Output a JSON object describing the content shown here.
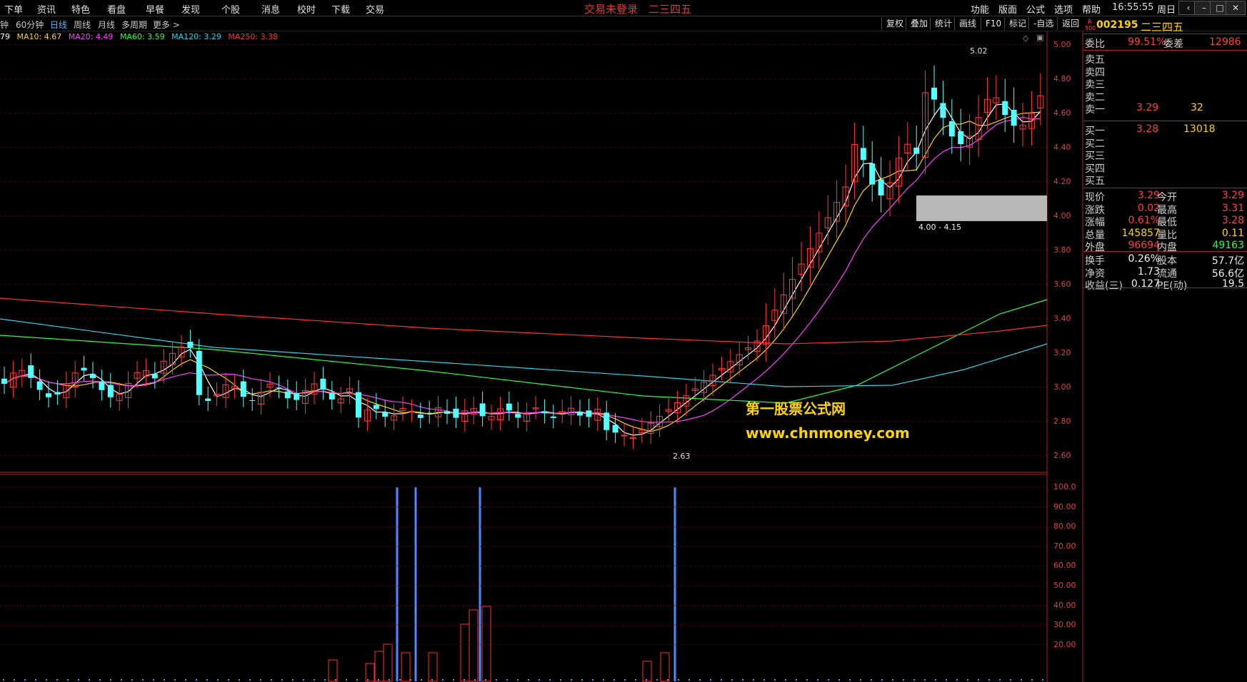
{
  "menubar": {
    "left_items": [
      "下单",
      "资讯",
      "特色",
      "看盘",
      "早餐",
      "发现",
      "个股",
      "消息",
      "校时",
      "下载",
      "交易"
    ],
    "title": "交易未登录　二三四五",
    "right_items": [
      "功能",
      "版面",
      "公式",
      "选项",
      "帮助"
    ],
    "clock": "16:55:55",
    "weekday": "周日",
    "window_buttons": [
      "‹",
      "–",
      "□",
      "✕"
    ]
  },
  "toolbar": {
    "periods": [
      "钟",
      "60分钟",
      "日线",
      "周线",
      "月线",
      "多周期",
      "更多 >"
    ],
    "active_period": "日线",
    "right_buttons": [
      "复权",
      "叠加",
      "统计",
      "画线",
      "F10",
      "标记",
      "-自选",
      "返回"
    ]
  },
  "ma_legend": [
    {
      "label": "79",
      "color": "#ffffff"
    },
    {
      "label": "MA10: 4.67",
      "color": "#ffd400"
    },
    {
      "label": "MA20: 4.49",
      "color": "#ff3cff"
    },
    {
      "label": "MA60: 3.59",
      "color": "#2bff3e"
    },
    {
      "label": "MA120: 3.29",
      "color": "#2bd4e8"
    },
    {
      "label": "MA250: 3.38",
      "color": "#ff3030"
    }
  ],
  "main_chart": {
    "y_ticks": [
      "5.00",
      "4.80",
      "4.60",
      "4.40",
      "4.20",
      "4.00",
      "3.80",
      "3.60",
      "3.40",
      "3.20",
      "3.00",
      "2.80",
      "2.60"
    ],
    "high_marker": "5.02",
    "low_marker": "2.63",
    "zone_label": "4.00 - 4.15",
    "y_range": [
      2.55,
      5.08
    ]
  },
  "indicator": {
    "y_ticks": [
      "100.0",
      "90.00",
      "80.00",
      "70.00",
      "60.00",
      "50.00",
      "40.00",
      "30.00",
      "20.00"
    ]
  },
  "watermark": {
    "line1": "第一股票公式网",
    "line2": "www.chnmoney.com"
  },
  "quote_panel": {
    "badge_top": "R",
    "badge_bottom": "500",
    "code": "002195",
    "name": "二三四五",
    "weibi_label": "委比",
    "weibi_value": "99.51%",
    "weicha_label": "委差",
    "weicha_value": "12986",
    "sell": [
      {
        "label": "卖五",
        "price": "",
        "vol": ""
      },
      {
        "label": "卖四",
        "price": "",
        "vol": ""
      },
      {
        "label": "卖三",
        "price": "",
        "vol": ""
      },
      {
        "label": "卖二",
        "price": "",
        "vol": ""
      },
      {
        "label": "卖一",
        "price": "3.29",
        "vol": "32"
      }
    ],
    "buy": [
      {
        "label": "买一",
        "price": "3.28",
        "vol": "13018"
      },
      {
        "label": "买二",
        "price": "",
        "vol": ""
      },
      {
        "label": "买三",
        "price": "",
        "vol": ""
      },
      {
        "label": "买四",
        "price": "",
        "vol": ""
      },
      {
        "label": "买五",
        "price": "",
        "vol": ""
      }
    ],
    "stats": [
      {
        "l1": "现价",
        "v1": "3.29",
        "c1": "red",
        "l2": "今开",
        "v2": "3.29",
        "c2": "red"
      },
      {
        "l1": "涨跌",
        "v1": "0.02",
        "c1": "red",
        "l2": "最高",
        "v2": "3.31",
        "c2": "red"
      },
      {
        "l1": "涨幅",
        "v1": "0.61%",
        "c1": "red",
        "l2": "最低",
        "v2": "3.28",
        "c2": "red"
      },
      {
        "l1": "总量",
        "v1": "145857",
        "c1": "yellow",
        "l2": "量比",
        "v2": "0.11",
        "c2": "yellow"
      },
      {
        "l1": "外盘",
        "v1": "96694",
        "c1": "red",
        "l2": "内盘",
        "v2": "49163",
        "c2": "green"
      }
    ],
    "stats2": [
      {
        "l1": "换手",
        "v1": "0.26%",
        "l2": "股本",
        "v2": "57.7亿"
      },
      {
        "l1": "净资",
        "v1": "1.73",
        "l2": "流通",
        "v2": "56.6亿"
      },
      {
        "l1": "收益(三)",
        "v1": "0.127",
        "l2": "PE(动)",
        "v2": "19.5"
      }
    ]
  }
}
